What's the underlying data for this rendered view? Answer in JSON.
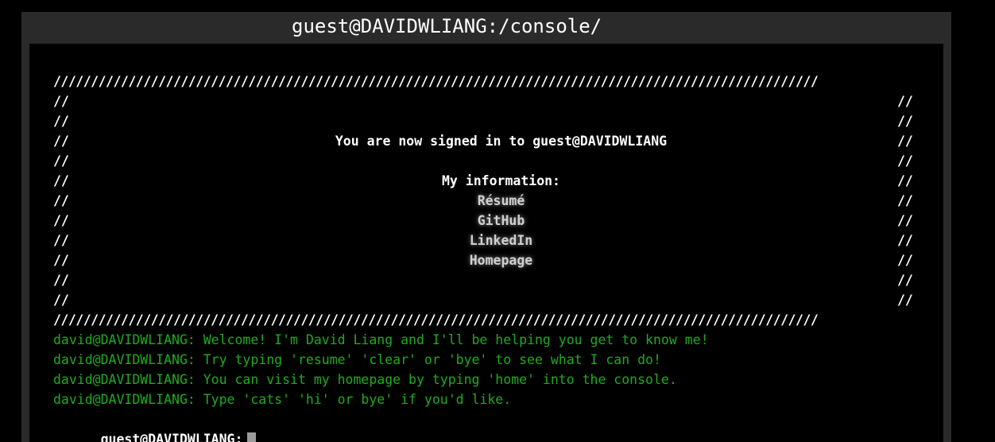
{
  "window": {
    "title": "guest@DAVIDWLIANG:/console/"
  },
  "banner": {
    "border_line": "//////////////////////////////////////////////////////////////////////////////////////////////////////",
    "edge": "//",
    "signed_in_text": "You are now signed in to guest@DAVIDWLIANG",
    "info_heading": "My information:",
    "links": [
      {
        "label": "Résumé"
      },
      {
        "label": "GitHub"
      },
      {
        "label": "LinkedIn"
      },
      {
        "label": "Homepage"
      }
    ]
  },
  "messages": [
    {
      "prefix": "david@DAVIDWLIANG:",
      "text": "Welcome! I'm David Liang and I'll be helping you get to know me!"
    },
    {
      "prefix": "david@DAVIDWLIANG:",
      "text": "Try typing 'resume' 'clear' or 'bye' to see what I can do!"
    },
    {
      "prefix": "david@DAVIDWLIANG:",
      "text": "You can visit my homepage by typing 'home' into the console."
    },
    {
      "prefix": "david@DAVIDWLIANG:",
      "text": "Type 'cats' 'hi' or bye' if you'd like."
    }
  ],
  "prompt": {
    "label": "guest@DAVIDWLIANG:",
    "value": ""
  },
  "colors": {
    "background": "#000000",
    "window_frame": "#2a2a2a",
    "text": "#ffffff",
    "bot_message": "#1faa1f",
    "link": "#cfcfcf",
    "cursor": "#9a9a9a"
  }
}
